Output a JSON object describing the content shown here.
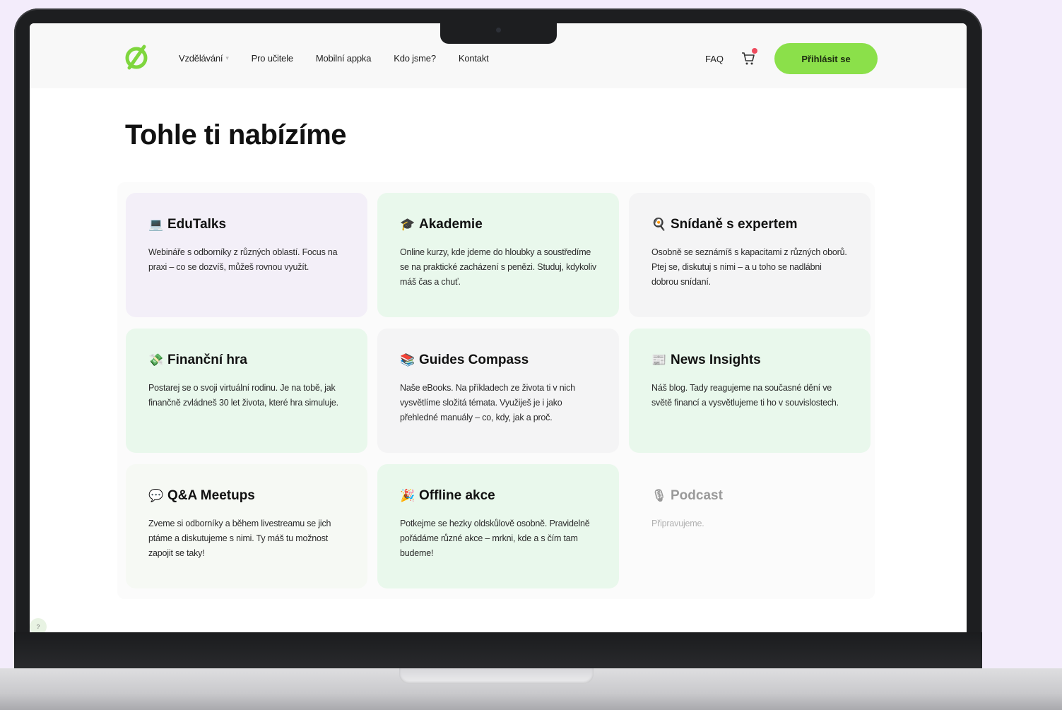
{
  "nav": {
    "links": [
      "Vzdělávání",
      "Pro učitele",
      "Mobilní appka",
      "Kdo jsme?",
      "Kontakt"
    ],
    "faq": "FAQ",
    "login": "Přihlásit se",
    "cart_badge_color": "#ef4b5e"
  },
  "page": {
    "title": "Tohle ti nabízíme"
  },
  "cards": [
    {
      "icon": "💻",
      "icon_name": "laptop-icon",
      "title": "EduTalks",
      "desc": "Webináře s odborníky z různých oblastí. Focus na praxi – co se dozvíš, můžeš rovnou využít."
    },
    {
      "icon": "🎓",
      "icon_name": "graduate-icon",
      "title": "Akademie",
      "desc": "Online kurzy, kde jdeme do hloubky a soustředíme se na praktické zacházení s penězi. Studuj, kdykoliv máš čas a chuť."
    },
    {
      "icon": "🍳",
      "icon_name": "breakfast-icon",
      "title": "Snídaně s expertem",
      "desc": "Osobně se seznámíš s kapacitami z různých oborů. Ptej se, diskutuj s nimi – a u toho se nadlábni dobrou snídaní."
    },
    {
      "icon": "💸",
      "icon_name": "money-icon",
      "title": "Finanční hra",
      "desc": "Postarej se o svoji virtuální rodinu. Je na tobě, jak finančně zvládneš 30 let života, které hra simuluje."
    },
    {
      "icon": "📚",
      "icon_name": "books-icon",
      "title": "Guides Compass",
      "desc": "Naše eBooks. Na příkladech ze života ti v nich vysvětlíme složitá témata. Využiješ je i jako přehledné manuály – co, kdy, jak a proč."
    },
    {
      "icon": "📰",
      "icon_name": "newspaper-icon",
      "title": "News Insights",
      "desc": "Náš blog. Tady reagujeme na současné dění ve světě financí a vysvětlujeme ti ho v souvislostech."
    },
    {
      "icon": "💬",
      "icon_name": "speech-bubble-icon",
      "title": "Q&A Meetups",
      "desc": "Zveme si odborníky a během livestreamu se jich ptáme a diskutujeme s nimi. Ty máš tu možnost zapojit se taky!"
    },
    {
      "icon": "🎉",
      "icon_name": "party-icon",
      "title": "Offline akce",
      "desc": "Potkejme se hezky oldskůlově osobně. Pravidelně pořádáme různé akce – mrkni, kde a s čím tam budeme!"
    },
    {
      "icon": "🎙",
      "icon_name": "microphone-icon",
      "title": "Podcast",
      "desc": "Připravujeme."
    }
  ],
  "colors": {
    "accent": "#8be04a",
    "lilac_card": "#f3eff8",
    "green_card": "#e9f8ec",
    "grey_card": "#f4f4f5"
  }
}
